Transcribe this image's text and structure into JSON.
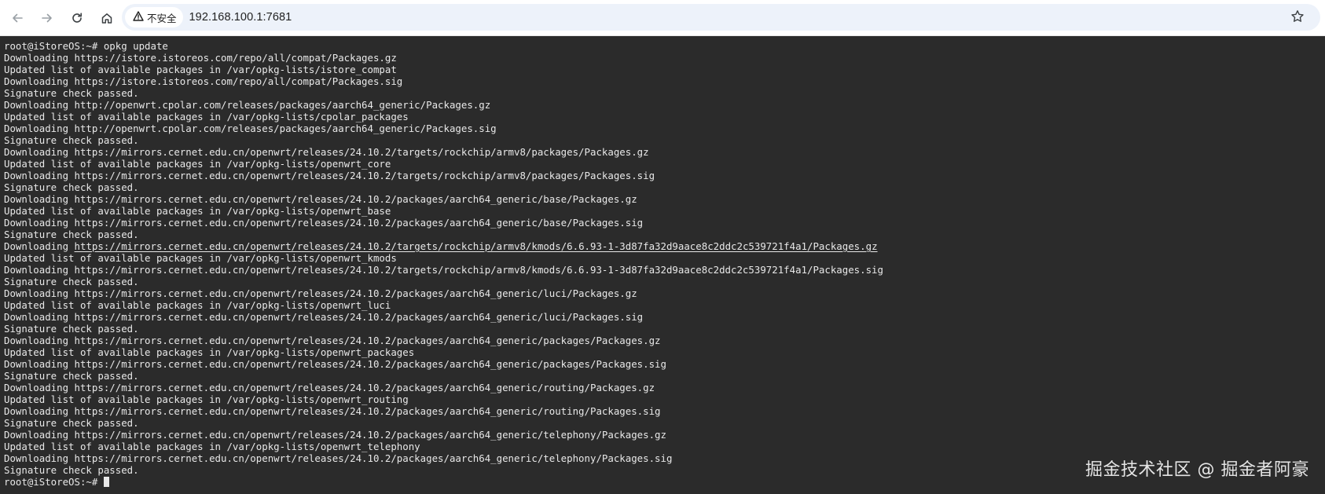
{
  "browser": {
    "security_label": "不安全",
    "url": "192.168.100.1:7681",
    "icons": [
      "back-icon",
      "forward-icon",
      "reload-icon",
      "home-icon",
      "warning-icon",
      "bookmark-star-icon"
    ]
  },
  "terminal": {
    "background": "#2b2b2b",
    "foreground": "#e8e8e8",
    "lines": [
      {
        "pre": "root@iStoreOS:~# opkg update",
        "link": "",
        "post": ""
      },
      {
        "pre": "Downloading https://istore.istoreos.com/repo/all/compat/Packages.gz",
        "link": "",
        "post": ""
      },
      {
        "pre": "Updated list of available packages in /var/opkg-lists/istore_compat",
        "link": "",
        "post": ""
      },
      {
        "pre": "Downloading https://istore.istoreos.com/repo/all/compat/Packages.sig",
        "link": "",
        "post": ""
      },
      {
        "pre": "Signature check passed.",
        "link": "",
        "post": ""
      },
      {
        "pre": "Downloading http://openwrt.cpolar.com/releases/packages/aarch64_generic/Packages.gz",
        "link": "",
        "post": ""
      },
      {
        "pre": "Updated list of available packages in /var/opkg-lists/cpolar_packages",
        "link": "",
        "post": ""
      },
      {
        "pre": "Downloading http://openwrt.cpolar.com/releases/packages/aarch64_generic/Packages.sig",
        "link": "",
        "post": ""
      },
      {
        "pre": "Signature check passed.",
        "link": "",
        "post": ""
      },
      {
        "pre": "Downloading https://mirrors.cernet.edu.cn/openwrt/releases/24.10.2/targets/rockchip/armv8/packages/Packages.gz",
        "link": "",
        "post": ""
      },
      {
        "pre": "Updated list of available packages in /var/opkg-lists/openwrt_core",
        "link": "",
        "post": ""
      },
      {
        "pre": "Downloading https://mirrors.cernet.edu.cn/openwrt/releases/24.10.2/targets/rockchip/armv8/packages/Packages.sig",
        "link": "",
        "post": ""
      },
      {
        "pre": "Signature check passed.",
        "link": "",
        "post": ""
      },
      {
        "pre": "Downloading https://mirrors.cernet.edu.cn/openwrt/releases/24.10.2/packages/aarch64_generic/base/Packages.gz",
        "link": "",
        "post": ""
      },
      {
        "pre": "Updated list of available packages in /var/opkg-lists/openwrt_base",
        "link": "",
        "post": ""
      },
      {
        "pre": "Downloading https://mirrors.cernet.edu.cn/openwrt/releases/24.10.2/packages/aarch64_generic/base/Packages.sig",
        "link": "",
        "post": ""
      },
      {
        "pre": "Signature check passed.",
        "link": "",
        "post": ""
      },
      {
        "pre": "Downloading ",
        "link": "https://mirrors.cernet.edu.cn/openwrt/releases/24.10.2/targets/rockchip/armv8/kmods/6.6.93-1-3d87fa32d9aace8c2ddc2c539721f4a1/Packages.gz",
        "post": ""
      },
      {
        "pre": "Updated list of available packages in /var/opkg-lists/openwrt_kmods",
        "link": "",
        "post": ""
      },
      {
        "pre": "Downloading https://mirrors.cernet.edu.cn/openwrt/releases/24.10.2/targets/rockchip/armv8/kmods/6.6.93-1-3d87fa32d9aace8c2ddc2c539721f4a1/Packages.sig",
        "link": "",
        "post": ""
      },
      {
        "pre": "Signature check passed.",
        "link": "",
        "post": ""
      },
      {
        "pre": "Downloading https://mirrors.cernet.edu.cn/openwrt/releases/24.10.2/packages/aarch64_generic/luci/Packages.gz",
        "link": "",
        "post": ""
      },
      {
        "pre": "Updated list of available packages in /var/opkg-lists/openwrt_luci",
        "link": "",
        "post": ""
      },
      {
        "pre": "Downloading https://mirrors.cernet.edu.cn/openwrt/releases/24.10.2/packages/aarch64_generic/luci/Packages.sig",
        "link": "",
        "post": ""
      },
      {
        "pre": "Signature check passed.",
        "link": "",
        "post": ""
      },
      {
        "pre": "Downloading https://mirrors.cernet.edu.cn/openwrt/releases/24.10.2/packages/aarch64_generic/packages/Packages.gz",
        "link": "",
        "post": ""
      },
      {
        "pre": "Updated list of available packages in /var/opkg-lists/openwrt_packages",
        "link": "",
        "post": ""
      },
      {
        "pre": "Downloading https://mirrors.cernet.edu.cn/openwrt/releases/24.10.2/packages/aarch64_generic/packages/Packages.sig",
        "link": "",
        "post": ""
      },
      {
        "pre": "Signature check passed.",
        "link": "",
        "post": ""
      },
      {
        "pre": "Downloading https://mirrors.cernet.edu.cn/openwrt/releases/24.10.2/packages/aarch64_generic/routing/Packages.gz",
        "link": "",
        "post": ""
      },
      {
        "pre": "Updated list of available packages in /var/opkg-lists/openwrt_routing",
        "link": "",
        "post": ""
      },
      {
        "pre": "Downloading https://mirrors.cernet.edu.cn/openwrt/releases/24.10.2/packages/aarch64_generic/routing/Packages.sig",
        "link": "",
        "post": ""
      },
      {
        "pre": "Signature check passed.",
        "link": "",
        "post": ""
      },
      {
        "pre": "Downloading https://mirrors.cernet.edu.cn/openwrt/releases/24.10.2/packages/aarch64_generic/telephony/Packages.gz",
        "link": "",
        "post": ""
      },
      {
        "pre": "Updated list of available packages in /var/opkg-lists/openwrt_telephony",
        "link": "",
        "post": ""
      },
      {
        "pre": "Downloading https://mirrors.cernet.edu.cn/openwrt/releases/24.10.2/packages/aarch64_generic/telephony/Packages.sig",
        "link": "",
        "post": ""
      },
      {
        "pre": "Signature check passed.",
        "link": "",
        "post": ""
      }
    ],
    "prompt": "root@iStoreOS:~# "
  },
  "watermark": "掘金技术社区 @ 掘金者阿豪"
}
